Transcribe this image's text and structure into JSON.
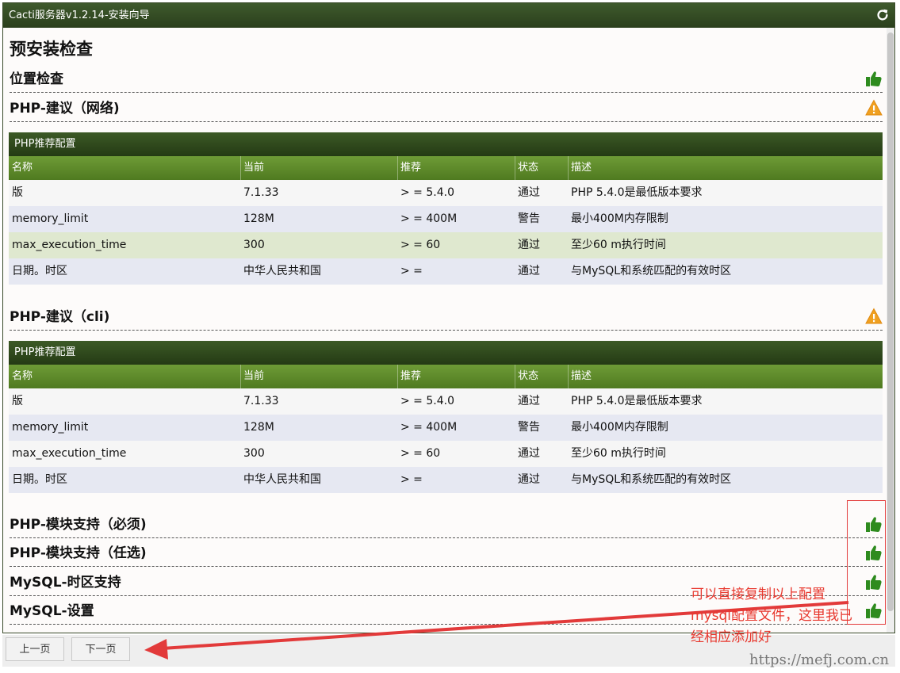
{
  "window": {
    "title": "Cacti服务器v1.2.14-安装向导",
    "refresh_icon": "refresh-icon"
  },
  "page": {
    "heading": "预安装检查",
    "sections": [
      {
        "title": "位置检查",
        "status": "ok"
      },
      {
        "title": "PHP-建议（网络)",
        "status": "warning"
      },
      {
        "title": "PHP-建议（cli)",
        "status": "warning"
      },
      {
        "title": "PHP-模块支持（必须)",
        "status": "ok"
      },
      {
        "title": "PHP-模块支持（任选)",
        "status": "ok"
      },
      {
        "title": "MySQL-时区支持",
        "status": "ok"
      },
      {
        "title": "MySQL-设置",
        "status": "ok"
      }
    ]
  },
  "tables": [
    {
      "caption": "PHP推荐配置",
      "columns": [
        "名称",
        "当前",
        "推荐",
        "状态",
        "描述"
      ],
      "rows": [
        [
          "版",
          "7.1.33",
          "> = 5.4.0",
          "通过",
          "PHP 5.4.0是最低版本要求"
        ],
        [
          "memory_limit",
          "128M",
          "> = 400M",
          "警告",
          "最小400M内存限制"
        ],
        [
          "max_execution_time",
          "300",
          "> = 60",
          "通过",
          "至少60 m执行时间"
        ],
        [
          "日期。时区",
          "中华人民共和国",
          "> =",
          "通过",
          "与MySQL和系统匹配的有效时区"
        ]
      ]
    },
    {
      "caption": "PHP推荐配置",
      "columns": [
        "名称",
        "当前",
        "推荐",
        "状态",
        "描述"
      ],
      "rows": [
        [
          "版",
          "7.1.33",
          "> = 5.4.0",
          "通过",
          "PHP 5.4.0是最低版本要求"
        ],
        [
          "memory_limit",
          "128M",
          "> = 400M",
          "警告",
          "最小400M内存限制"
        ],
        [
          "max_execution_time",
          "300",
          "> = 60",
          "通过",
          "至少60 m执行时间"
        ],
        [
          "日期。时区",
          "中华人民共和国",
          "> =",
          "通过",
          "与MySQL和系统匹配的有效时区"
        ]
      ]
    }
  ],
  "footer": {
    "prev_label": "上一页",
    "next_label": "下一页"
  },
  "annotation": {
    "lines": [
      "可以直接复制以上配置",
      "mysql配置文件，这里我已",
      "经相应添加好"
    ],
    "color": "#e8382e"
  },
  "watermark": "https://mefj.com.cn",
  "colors": {
    "title_bar": "#2f4a22",
    "table_header": "#5f8c2a",
    "ok_icon": "#2e8b1e",
    "warning_icon": "#f0a020"
  }
}
